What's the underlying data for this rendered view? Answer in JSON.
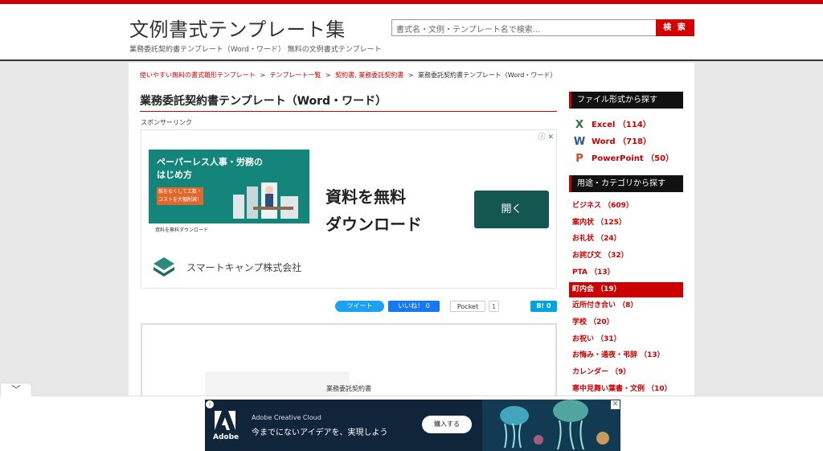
{
  "header": {
    "site_title": "文例書式テンプレート集",
    "site_subtitle": "業務委託契約書テンプレート（Word・ワード） 無料の文例書式テンプレート",
    "search_placeholder": "書式名・文例・テンプレート名で検索...",
    "search_button": "検 索"
  },
  "breadcrumb": {
    "items": [
      "使いやすい無料の書式雛形テンプレート",
      "テンプレート一覧",
      "契約書, 業務委託契約書"
    ],
    "current": "業務委託契約書テンプレート（Word・ワード）",
    "separator": ">"
  },
  "main": {
    "title": "業務委託契約書テンプレート（Word・ワード）",
    "sponsor_label": "スポンサーリンク",
    "preview_doc_title": "業務委託契約書"
  },
  "ad": {
    "image_headline": "ペーパーレス人事・労務の\nはじめ方",
    "image_tag": "紙をなくして工数・\nコストを大幅削減！",
    "image_footer": "資料を無料ダウンロード",
    "headline": "資料を無料\nダウンロード",
    "open_button": "開く",
    "company": "スマートキャンプ株式会社",
    "adchoice": "ⓘ ✕"
  },
  "share": {
    "tweet": "ツイート",
    "like": "いいね！ 0",
    "pocket": "Pocket",
    "pocket_count": "1",
    "hatena": "B! 0"
  },
  "sidebar": {
    "file_heading": "ファイル形式から探す",
    "file_types": [
      {
        "label": "Excel （114）",
        "icon": "excel-icon",
        "glyph": "X",
        "color": "#1f7a3a"
      },
      {
        "label": "Word （718）",
        "icon": "word-icon",
        "glyph": "W",
        "color": "#2b5797"
      },
      {
        "label": "PowerPoint （50）",
        "icon": "powerpoint-icon",
        "glyph": "P",
        "color": "#d04525"
      }
    ],
    "category_heading": "用途・カテゴリから探す",
    "categories": [
      {
        "label": "ビジネス （609）",
        "active": false
      },
      {
        "label": "案内状 （125）",
        "active": false
      },
      {
        "label": "お礼状 （24）",
        "active": false
      },
      {
        "label": "お詫び文 （32）",
        "active": false
      },
      {
        "label": "PTA （13）",
        "active": false
      },
      {
        "label": "町内会 （19）",
        "active": true
      },
      {
        "label": "近所付き合い （8）",
        "active": false
      },
      {
        "label": "学校 （20）",
        "active": false
      },
      {
        "label": "お祝い （31）",
        "active": false
      },
      {
        "label": "お悔み・通夜・弔辞 （13）",
        "active": false
      },
      {
        "label": "カレンダー （9）",
        "active": false
      },
      {
        "label": "寒中見舞い葉書・文例 （10）",
        "active": false
      }
    ]
  },
  "bottom_ad": {
    "collapse_icon": "chevron-down-icon",
    "collapse_glyph": "﹀",
    "logo_text": "Adobe",
    "brand": "Adobe Creative Cloud",
    "tagline": "今までにないアイデアを、実現しよう",
    "buy_button": "購入する",
    "close": "✕",
    "info": "i"
  },
  "colors": {
    "accent": "#cc0000",
    "ad_teal": "#14857a",
    "ad_button": "#145650",
    "adobe_bg": "#10243a"
  }
}
